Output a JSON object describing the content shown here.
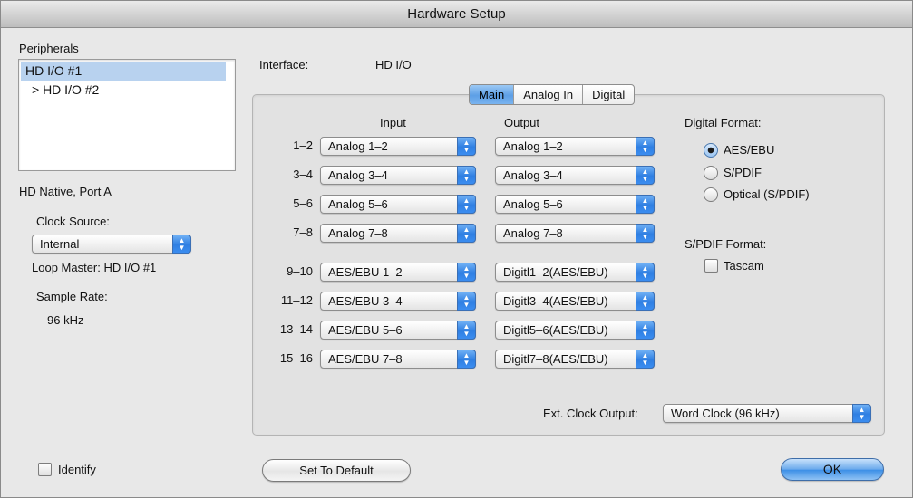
{
  "window": {
    "title": "Hardware Setup"
  },
  "peripherals": {
    "label": "Peripherals",
    "items": [
      "HD I/O #1",
      "> HD I/O #2"
    ]
  },
  "port_label": "HD Native, Port A",
  "clock_source": {
    "label": "Clock Source:",
    "value": "Internal"
  },
  "loop_master": "Loop Master: HD I/O #1",
  "sample_rate": {
    "label": "Sample Rate:",
    "value": "96 kHz"
  },
  "identify_label": "Identify",
  "interface": {
    "label": "Interface:",
    "value": "HD I/O"
  },
  "tabs": [
    "Main",
    "Analog In",
    "Digital"
  ],
  "io": {
    "input_header": "Input",
    "output_header": "Output",
    "rows": [
      {
        "ch": "1–2",
        "input": "Analog 1–2",
        "output": "Analog 1–2"
      },
      {
        "ch": "3–4",
        "input": "Analog 3–4",
        "output": "Analog 3–4"
      },
      {
        "ch": "5–6",
        "input": "Analog 5–6",
        "output": "Analog 5–6"
      },
      {
        "ch": "7–8",
        "input": "Analog 7–8",
        "output": "Analog 7–8"
      },
      {
        "ch": "9–10",
        "input": "AES/EBU 1–2",
        "output": "Digitl1–2(AES/EBU)"
      },
      {
        "ch": "11–12",
        "input": "AES/EBU 3–4",
        "output": "Digitl3–4(AES/EBU)"
      },
      {
        "ch": "13–14",
        "input": "AES/EBU 5–6",
        "output": "Digitl5–6(AES/EBU)"
      },
      {
        "ch": "15–16",
        "input": "AES/EBU 7–8",
        "output": "Digitl7–8(AES/EBU)"
      }
    ]
  },
  "digital_format": {
    "label": "Digital Format:",
    "options": [
      "AES/EBU",
      "S/PDIF",
      "Optical (S/PDIF)"
    ],
    "selected": "AES/EBU"
  },
  "spdif_format": {
    "label": "S/PDIF Format:",
    "tascam_label": "Tascam"
  },
  "ext_clock": {
    "label": "Ext. Clock Output:",
    "value": "Word Clock (96 kHz)"
  },
  "buttons": {
    "set_default": "Set To Default",
    "ok": "OK"
  }
}
